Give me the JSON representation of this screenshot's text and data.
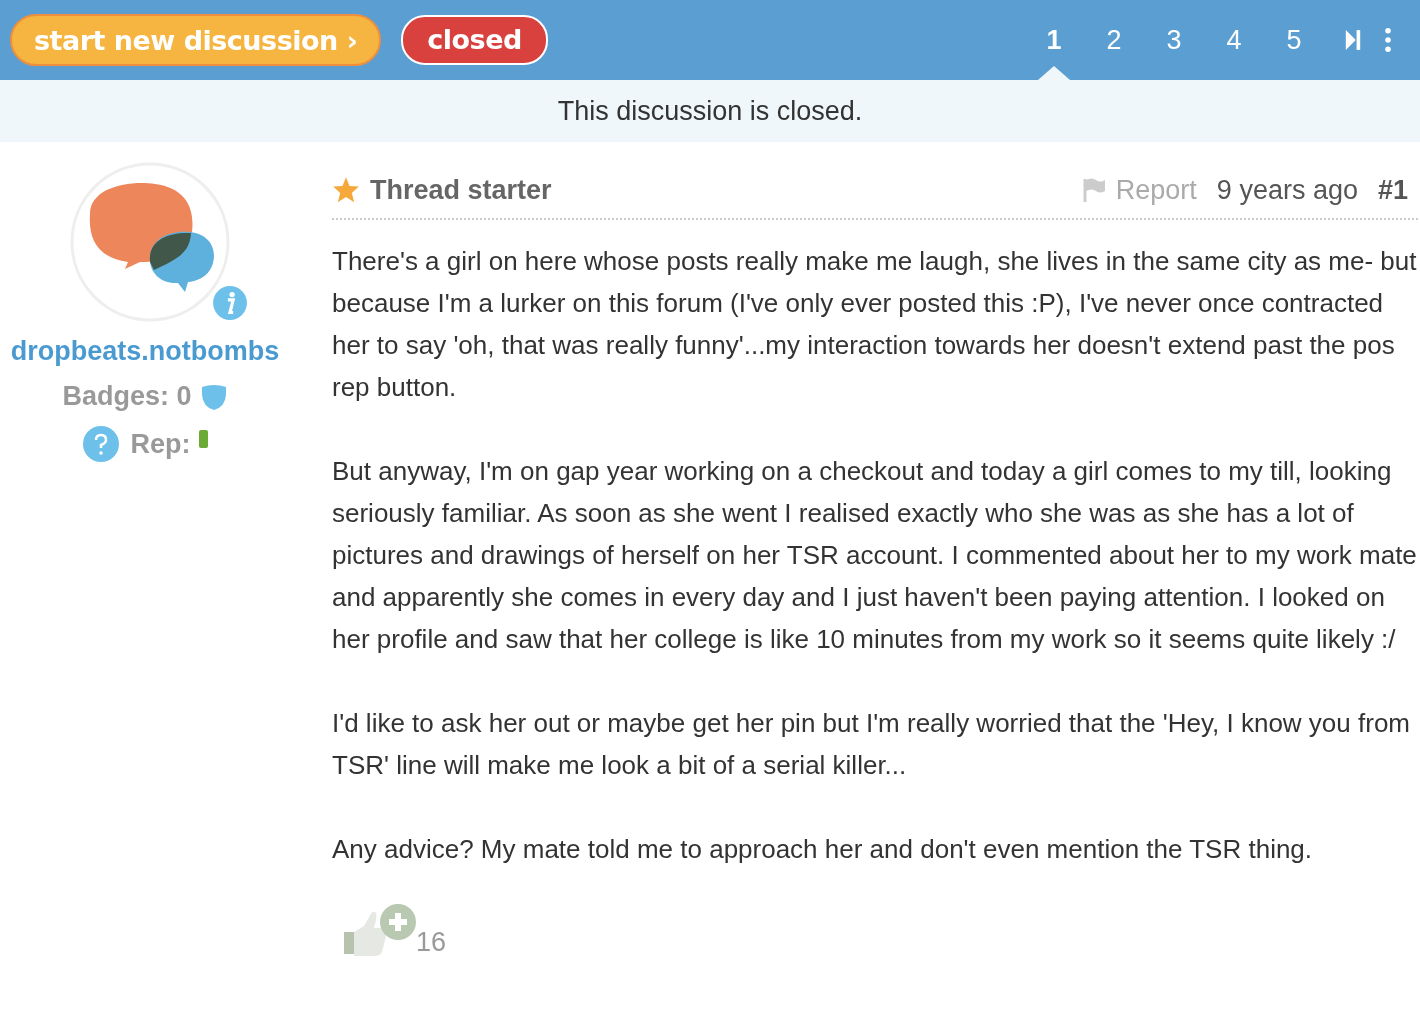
{
  "toolbar": {
    "new_discussion": "start new discussion ›",
    "status_badge": "closed"
  },
  "pagination": {
    "pages": [
      {
        "label": "1",
        "selected": true
      },
      {
        "label": "2",
        "selected": false
      },
      {
        "label": "3",
        "selected": false
      },
      {
        "label": "4",
        "selected": false
      },
      {
        "label": "5",
        "selected": false
      }
    ]
  },
  "notice": "This discussion is closed.",
  "post": {
    "author": {
      "name": "dropbeats.notbombs",
      "badges": "Badges: 0",
      "rep": "Rep:"
    },
    "role": "Thread starter",
    "report": "Report",
    "time": "9 years ago",
    "number": "#1",
    "paragraphs": [
      "There's a girl on here whose posts really make me laugh, she lives in the same city as me- but because I'm a lurker on this forum (I've only ever posted this :P), I've never once contracted her to say 'oh, that was really funny'...my interaction towards her doesn't extend past the pos rep button.",
      "But anyway, I'm on gap year working on a checkout and today a girl comes to my till, looking seriously familiar. As soon as she went I realised exactly who she was as she has a lot of pictures and drawings of herself on her TSR account. I commented about her to my work mate and apparently she comes in every day and I just haven't been paying attention. I looked on her profile and saw that her college is like 10 minutes from my work so it seems quite likely :/",
      "I'd like to ask her out or maybe get her pin but I'm really worried that the 'Hey, I know you from TSR' line will make me look a bit of a serial killer...",
      "Any advice? My mate told me to approach her and don't even mention the TSR thing."
    ],
    "likes": "16"
  }
}
